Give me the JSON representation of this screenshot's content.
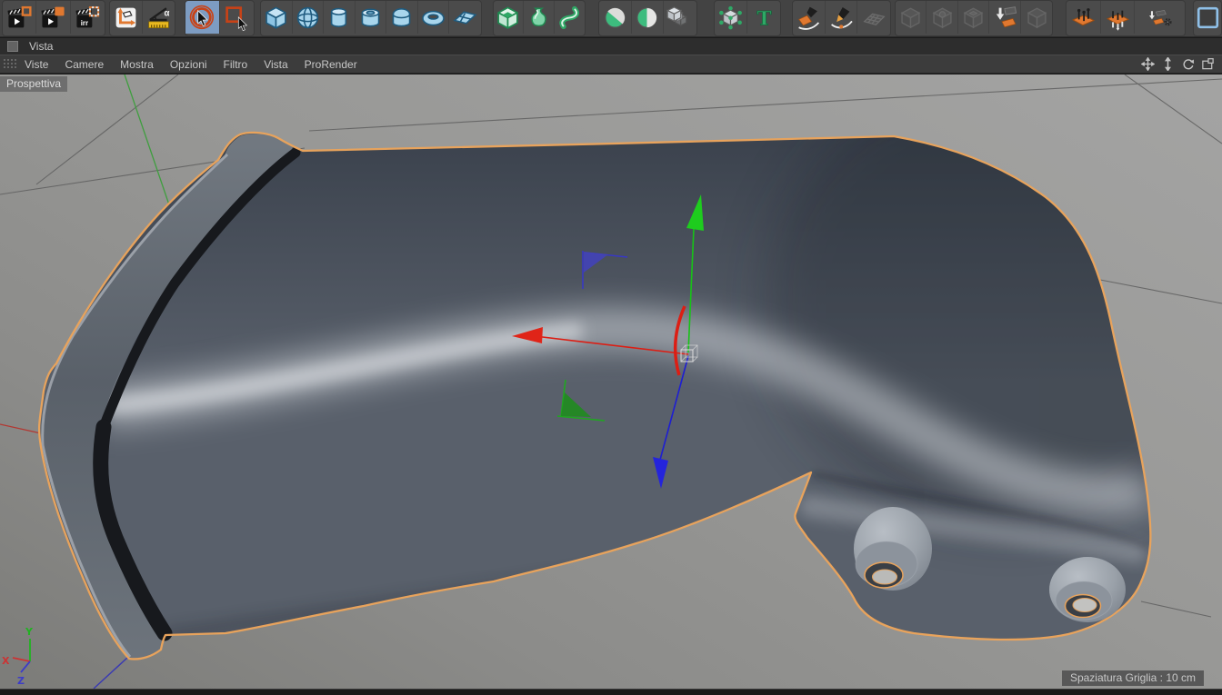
{
  "window": {
    "panel_title": "Vista"
  },
  "toolbar": {
    "irr_label": "irr",
    "measure_alpha": "α",
    "text_tool_label": "T",
    "icons": [
      "render-view-icon",
      "render-to-picture-viewer-icon",
      "interactive-render-region-icon",
      "workplane-icon",
      "measure-icon",
      "live-selection-icon",
      "rectangle-selection-icon",
      "cube-primitive-icon",
      "sphere-primitive-icon",
      "cylinder-primitive-icon",
      "tube-primitive-icon",
      "oil-tank-primitive-icon",
      "torus-primitive-icon",
      "plane-primitive-icon",
      "subdivision-surface-icon",
      "lathe-icon",
      "sweep-icon",
      "boole-icon",
      "symmetry-icon",
      "array-icon",
      "atom-array-icon",
      "motext-icon",
      "spline-pen-icon",
      "spline-sketch-icon",
      "spline-grid-icon",
      "volume-builder-icon",
      "volume-sphere-icon",
      "volume-cube-icon",
      "volume-mesher-icon",
      "volume-cache-icon",
      "place-objects-icon",
      "scatter-objects-icon",
      "remesh-gear-icon",
      "layout-square-icon"
    ],
    "active_tool": "live-selection"
  },
  "menubar": {
    "items": [
      "Viste",
      "Camere",
      "Mostra",
      "Opzioni",
      "Filtro",
      "Vista",
      "ProRender"
    ],
    "nav_icons": [
      "pan-icon",
      "zoom-icon",
      "rotate-icon",
      "maximize-view-icon"
    ]
  },
  "viewport": {
    "camera_label": "Prospettiva",
    "grid_status": "Spaziatura Griglia : 10 cm",
    "axis": {
      "x": "X",
      "y": "Y",
      "z": "Z"
    },
    "selected_object": "mechanical-cover-part"
  },
  "colors": {
    "selection_outline": "#E8A35C",
    "axis_x": "#DC1E14",
    "axis_y": "#17C317",
    "axis_z": "#1E1ED2",
    "active_tool_bg": "#7D9CC2",
    "viewport_background": "#97979A",
    "toolbar_background": "#434343"
  }
}
